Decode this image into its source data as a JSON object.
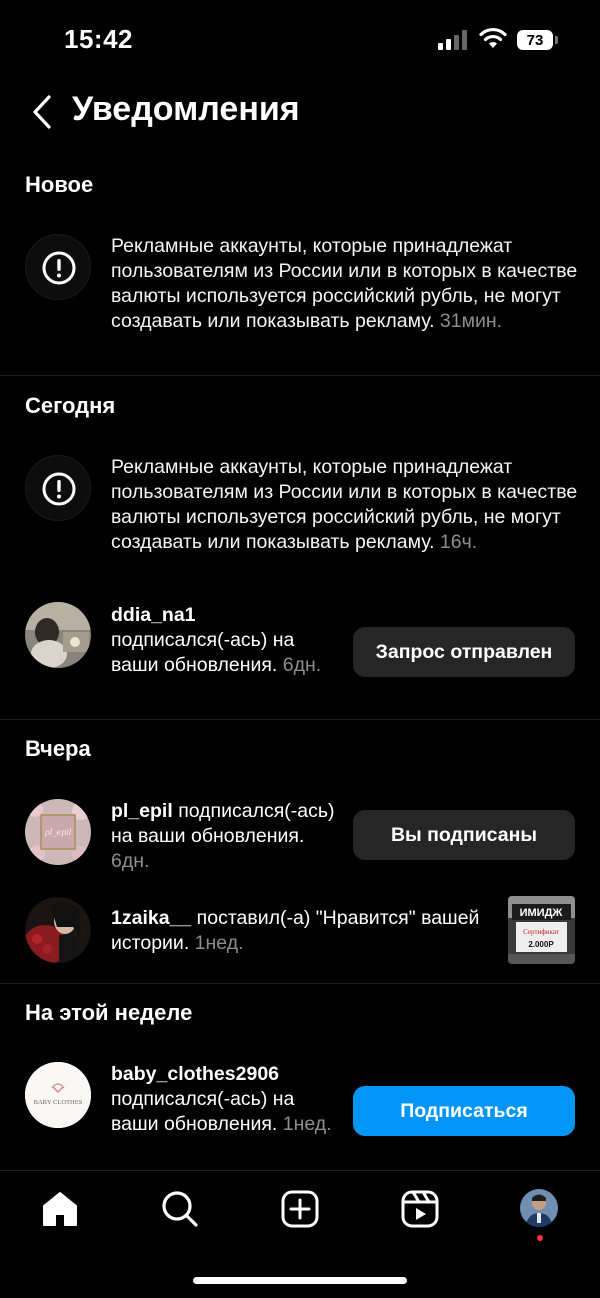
{
  "status_bar": {
    "time": "15:42",
    "battery": "73"
  },
  "header": {
    "title": "Уведомления"
  },
  "sections": {
    "new": {
      "title": "Новое"
    },
    "today": {
      "title": "Сегодня"
    },
    "yesterday": {
      "title": "Вчера"
    },
    "this_week": {
      "title": "На этой неделе"
    }
  },
  "notifications": {
    "ad_new": {
      "text": "Рекламные аккаунты, которые принадлежат пользователям из России или в которых в качестве валюты используется российский рубль, не могут создавать или показывать рекламу.",
      "time": "31мин."
    },
    "ad_today": {
      "text": "Рекламные аккаунты, которые принадлежат пользователям из России или в которых в качестве валюты используется российский рубль, не могут создавать или показывать рекламу.",
      "time": "16ч."
    },
    "follow_ddia": {
      "username": "ddia_na1",
      "action": "подписался(-ась) на ваши обновления.",
      "time": "6дн.",
      "button": "Запрос отправлен"
    },
    "follow_plepil": {
      "username": "pl_epil",
      "action": "подписался(-ась) на ваши обновления.",
      "time": "6дн.",
      "button": "Вы подписаны"
    },
    "like_1zaika": {
      "username": "1zaika__",
      "action": "поставил(-а) \"Нравится\" вашей истории.",
      "time": "1нед."
    },
    "follow_baby": {
      "username": "baby_clothes2906",
      "action": "подписался(-ась) на ваши обновления.",
      "time": "1нед.",
      "button": "Подписаться"
    }
  },
  "avatars": {
    "plepil_logo": "pl_epil",
    "baby_logo": "BABY CLOTHES"
  },
  "thumbnail": {
    "line1": "ИМИДЖ",
    "line2": "Сертификат",
    "line3": "2.000Р"
  },
  "colors": {
    "accent_blue": "#0095f6",
    "button_gray": "#262626",
    "muted": "#8e8e8e",
    "notification_dot": "#ff3040"
  }
}
